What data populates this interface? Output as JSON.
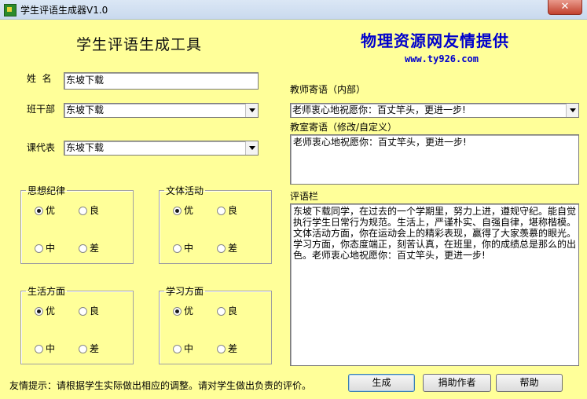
{
  "window": {
    "title": "学生评语生成器V1.0",
    "close_label": "✕"
  },
  "header": {
    "title": "学生评语生成工具",
    "sponsor": "物理资源网友情提供",
    "url": "www.ty926.com"
  },
  "form": {
    "name_label": "姓  名",
    "name_value": "东坡下载",
    "cadre_label": "班干部",
    "cadre_value": "东坡下载",
    "rep_label": "课代表",
    "rep_value": "东坡下载"
  },
  "groups": {
    "ideology": {
      "title": "思想纪律",
      "opt1": "优",
      "opt2": "良",
      "opt3": "中",
      "opt4": "差",
      "selected": "优"
    },
    "arts": {
      "title": "文体活动",
      "opt1": "优",
      "opt2": "良",
      "opt3": "中",
      "opt4": "差",
      "selected": "优"
    },
    "life": {
      "title": "生活方面",
      "opt1": "优",
      "opt2": "良",
      "opt3": "中",
      "opt4": "差",
      "selected": "优"
    },
    "study": {
      "title": "学习方面",
      "opt1": "优",
      "opt2": "良",
      "opt3": "中",
      "opt4": "差",
      "selected": "优"
    }
  },
  "right": {
    "teacher_label": "教师寄语（内部）",
    "teacher_value": "老师衷心地祝愿你：百丈竿头，更进一步!",
    "office_label": "教室寄语（修改/自定义）",
    "office_value": "老师衷心地祝愿你：百丈竿头，更进一步!",
    "comment_label": "评语栏",
    "comment_value": "东坡下载同学，在过去的一个学期里，努力上进，遵规守纪。能自觉执行学生日常行为规范。生活上，严谨朴实、自强自律，堪称楷模。文体活动方面，你在运动会上的精彩表现，赢得了大家羡慕的眼光。学习方面，你态度端正，刻苦认真，在班里，你的成绩总是那么的出色。老师衷心地祝愿你：百丈竿头，更进一步!"
  },
  "footer": {
    "hint": "友情提示：请根据学生实际做出相应的调整。请对学生做出负责的评价。",
    "generate_label": "生成",
    "donate_label": "捐助作者",
    "help_label": "帮助"
  }
}
